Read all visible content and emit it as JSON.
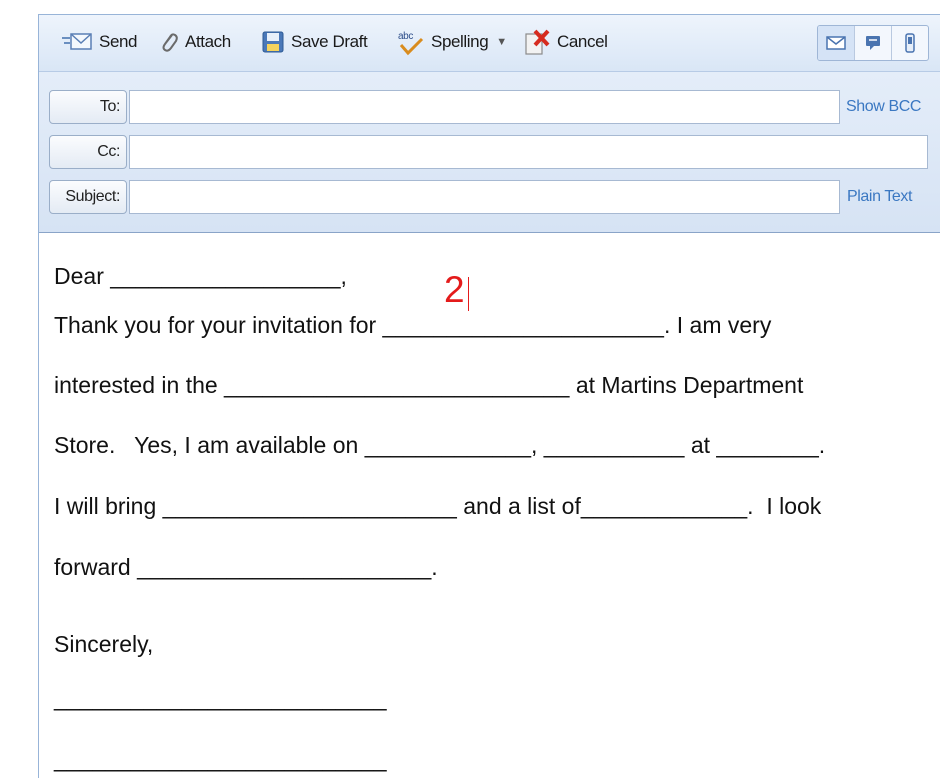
{
  "toolbar": {
    "send_label": "Send",
    "attach_label": "Attach",
    "save_draft_label": "Save Draft",
    "spelling_label": "Spelling",
    "cancel_label": "Cancel",
    "view_buttons": [
      "envelope-icon",
      "popup-icon",
      "phone-icon"
    ]
  },
  "header": {
    "to_label": "To:",
    "to_value": "",
    "cc_label": "Cc:",
    "cc_value": "",
    "subject_label": "Subject:",
    "subject_value": "",
    "show_bcc_link": "Show BCC",
    "plain_text_link": "Plain Text"
  },
  "body": {
    "marker": "2",
    "lines": [
      "Dear __________________,",
      "Thank you for your invitation for ______________________. I am very",
      "interested in the ___________________________ at Martins Department",
      "Store.   Yes, I am available on _____________, ___________ at ________.",
      "I will bring _______________________ and a list of_____________.  I look",
      "forward _______________________.",
      "Sincerely,",
      "__________________________",
      "__________________________"
    ]
  },
  "colors": {
    "toolbar_bg": "#d9e6f6",
    "link": "#3b78c2",
    "marker": "#e41b1b"
  }
}
